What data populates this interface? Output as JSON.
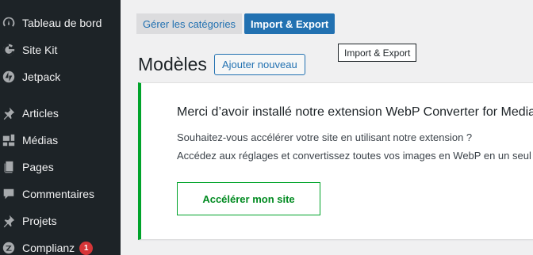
{
  "sidebar": {
    "items": [
      {
        "label": "Tableau de bord",
        "icon": "dashboard-icon"
      },
      {
        "label": "Site Kit",
        "icon": "google-g-icon"
      },
      {
        "label": "Jetpack",
        "icon": "jetpack-icon"
      },
      {
        "label": "Articles",
        "icon": "pin-icon"
      },
      {
        "label": "Médias",
        "icon": "media-icon"
      },
      {
        "label": "Pages",
        "icon": "pages-icon"
      },
      {
        "label": "Commentaires",
        "icon": "comment-icon"
      },
      {
        "label": "Projets",
        "icon": "pin-icon"
      },
      {
        "label": "Complianz",
        "icon": "complianz-icon",
        "badge": "1"
      }
    ]
  },
  "toolbar": {
    "categories_label": "Gérer les catégories",
    "import_export_label": "Import & Export",
    "tooltip": "Import & Export"
  },
  "header": {
    "title": "Modèles",
    "add_new_label": "Ajouter nouveau"
  },
  "notice": {
    "title": "Merci d’avoir installé notre extension WebP Converter for Media !",
    "line1": "Souhaitez-vous accélérer votre site en utilisant notre extension ?",
    "line2": "Accédez aux réglages et convertissez toutes vos images en WebP en un seul clic.",
    "cta_label": "Accélérer mon site"
  },
  "colors": {
    "sidebar_bg": "#1d2327",
    "accent": "#2271b1",
    "success": "#00a32a",
    "badge": "#d63638"
  }
}
